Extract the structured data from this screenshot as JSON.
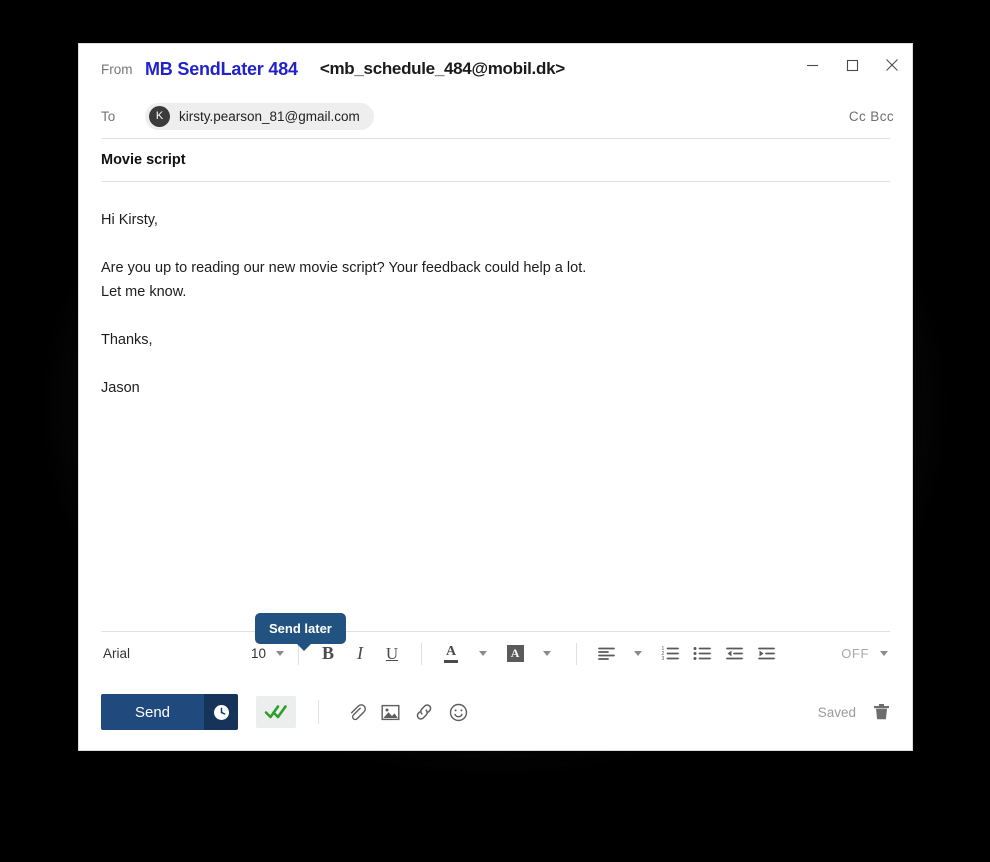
{
  "window": {
    "controls": [
      {
        "name": "minimize",
        "glyph": "minimize-icon"
      },
      {
        "name": "maximize",
        "glyph": "maximize-icon"
      },
      {
        "name": "close",
        "glyph": "close-icon"
      }
    ]
  },
  "compose": {
    "from_label": "From",
    "from_name": "MB SendLater 484",
    "from_address": "<mb_schedule_484@mobil.dk>",
    "to_label": "To",
    "recipient_initial": "K",
    "recipient_email": "kirsty.pearson_81@gmail.com",
    "ccbcc_label": "Cc Bcc",
    "subject": "Movie script",
    "body_lines": [
      "Hi Kirsty,",
      "",
      "Are you up to reading our new movie script? Your feedback could help a lot.",
      "Let me know.",
      "",
      "Thanks,",
      "",
      "Jason"
    ]
  },
  "toolbar": {
    "font_family_value": "Arial",
    "font_size_value": "10",
    "bold_label": "B",
    "italic_label": "I",
    "underline_label": "U",
    "font_color_letter": "A",
    "highlight_letter": "A",
    "align_icon": "align-left-icon",
    "numbered_list_icon": "numbered-list-icon",
    "bullet_list_icon": "bullet-list-icon",
    "decrease_indent_icon": "decrease-indent-icon",
    "increase_indent_icon": "increase-indent-icon",
    "tracking_value": "OFF"
  },
  "actions": {
    "send_label": "Send",
    "send_later_icon": "clock-icon",
    "read_receipt_icon": "double-check-icon",
    "attach_icon": "paperclip-icon",
    "image_icon": "image-icon",
    "link_icon": "link-icon",
    "emoji_icon": "smiley-icon",
    "saved_label": "Saved",
    "discard_icon": "trash-icon"
  },
  "tooltip": {
    "text": "Send later"
  },
  "colors": {
    "from_name": "#2222cc",
    "send_button": "#20497d",
    "send_clock": "#16345a",
    "tooltip_bg": "#22527f",
    "check_green": "#2ca02c",
    "backdrop": "#000000"
  }
}
